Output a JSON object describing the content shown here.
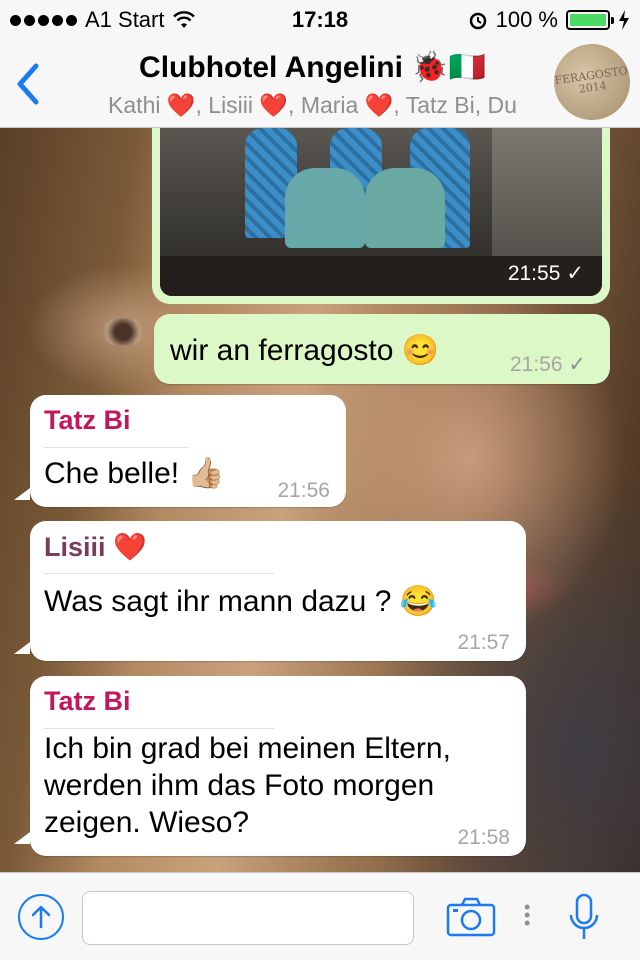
{
  "status_bar": {
    "carrier": "A1 Start",
    "time": "17:18",
    "battery": "100 %"
  },
  "header": {
    "title": "Clubhotel Angelini 🐞🇮🇹",
    "members": "Kathi ❤️, Lisiii ❤️, Maria ❤️, Tatz Bi, Du",
    "avatar_text": "FERAGOSTO 2014"
  },
  "messages": [
    {
      "type": "photo",
      "direction": "out",
      "time": "21:55",
      "status": "✓"
    },
    {
      "type": "text",
      "direction": "out",
      "text": "wir an ferragosto 😊",
      "time": "21:56",
      "status": "✓"
    },
    {
      "type": "text",
      "direction": "in",
      "sender": "Tatz Bi",
      "sender_color": "#c2185b",
      "text": "Che belle! 👍🏼",
      "time": "21:56"
    },
    {
      "type": "text",
      "direction": "in",
      "sender": "Lisiii ❤️",
      "sender_color": "#7b3b5b",
      "text": "Was sagt ihr mann dazu ? 😂",
      "time": "21:57"
    },
    {
      "type": "text",
      "direction": "in",
      "sender": "Tatz Bi",
      "sender_color": "#c2185b",
      "text_lines": [
        "Ich bin grad bei meinen Eltern,",
        "werden ihm das Foto morgen",
        "zeigen. Wieso?"
      ],
      "time": "21:58"
    }
  ],
  "input": {
    "value": "",
    "placeholder": ""
  },
  "colors": {
    "accent": "#1a7cf0",
    "out_bubble": "#dcf8c6",
    "in_bubble": "#ffffff"
  },
  "icons": [
    "back-chevron-icon",
    "upload-icon",
    "camera-icon",
    "mic-icon",
    "wifi-icon",
    "alarm-icon",
    "charging-icon"
  ]
}
